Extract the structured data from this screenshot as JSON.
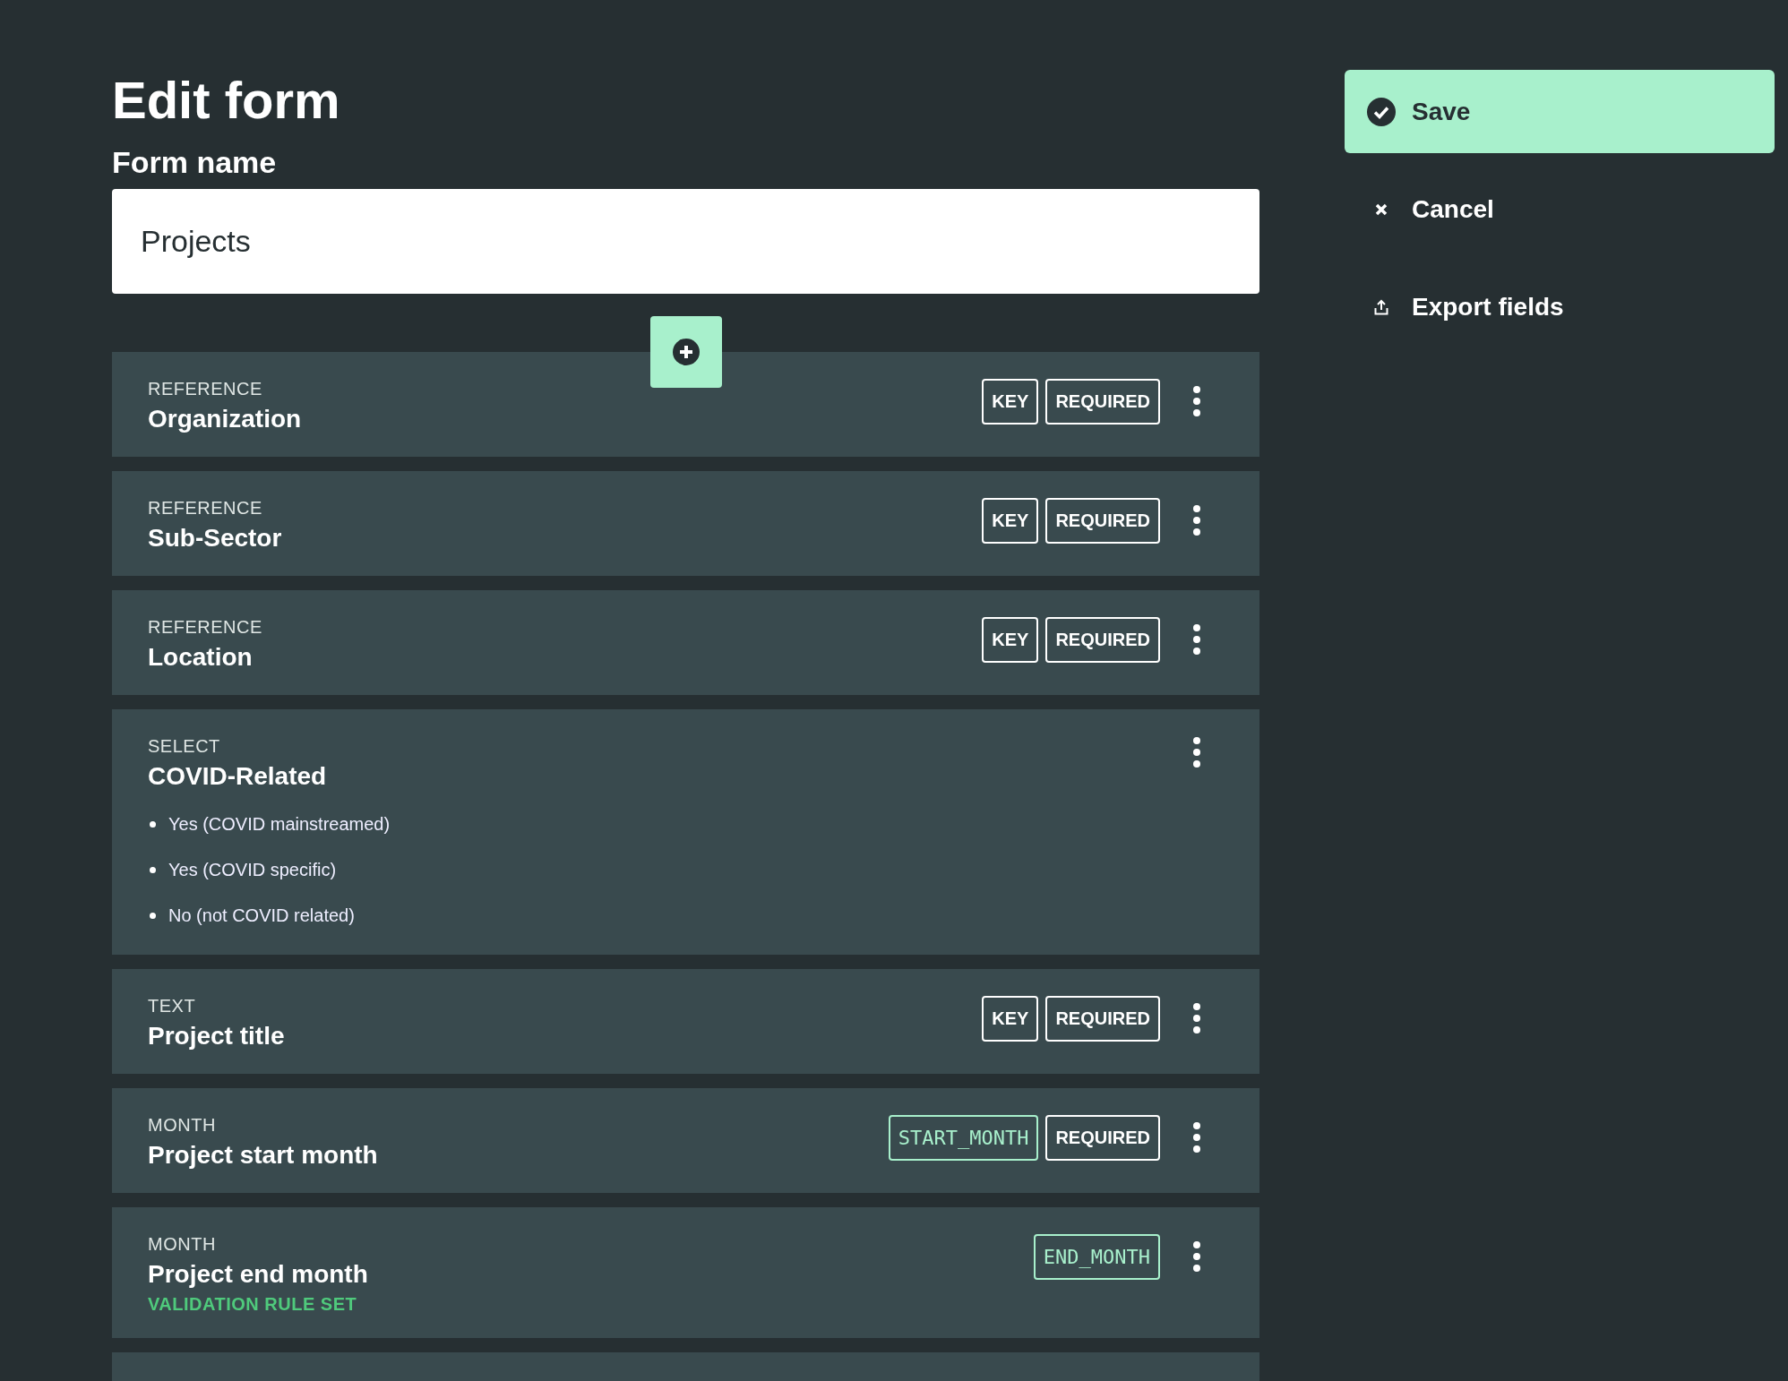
{
  "page": {
    "title": "Edit form"
  },
  "form_name": {
    "label": "Form name",
    "value": "Projects"
  },
  "fields": [
    {
      "type": "REFERENCE",
      "name": "Organization",
      "tags": [
        {
          "kind": "flag",
          "text": "KEY"
        },
        {
          "kind": "flag",
          "text": "REQUIRED"
        }
      ]
    },
    {
      "type": "REFERENCE",
      "name": "Sub-Sector",
      "tags": [
        {
          "kind": "flag",
          "text": "KEY"
        },
        {
          "kind": "flag",
          "text": "REQUIRED"
        }
      ]
    },
    {
      "type": "REFERENCE",
      "name": "Location",
      "tags": [
        {
          "kind": "flag",
          "text": "KEY"
        },
        {
          "kind": "flag",
          "text": "REQUIRED"
        }
      ]
    },
    {
      "type": "SELECT",
      "name": "COVID-Related",
      "options": [
        "Yes (COVID mainstreamed)",
        "Yes (COVID specific)",
        "No (not COVID related)"
      ]
    },
    {
      "type": "TEXT",
      "name": "Project title",
      "tags": [
        {
          "kind": "flag",
          "text": "KEY"
        },
        {
          "kind": "flag",
          "text": "REQUIRED"
        }
      ]
    },
    {
      "type": "MONTH",
      "name": "Project start month",
      "tags": [
        {
          "kind": "code",
          "text": "START_MONTH"
        },
        {
          "kind": "flag",
          "text": "REQUIRED"
        }
      ]
    },
    {
      "type": "MONTH",
      "name": "Project end month",
      "note": "VALIDATION RULE SET",
      "tags": [
        {
          "kind": "code",
          "text": "END_MONTH"
        }
      ]
    }
  ],
  "actions": [
    {
      "kind": "save",
      "label": "Save"
    },
    {
      "kind": "cancel",
      "label": "Cancel"
    },
    {
      "kind": "export",
      "label": "Export fields"
    }
  ]
}
